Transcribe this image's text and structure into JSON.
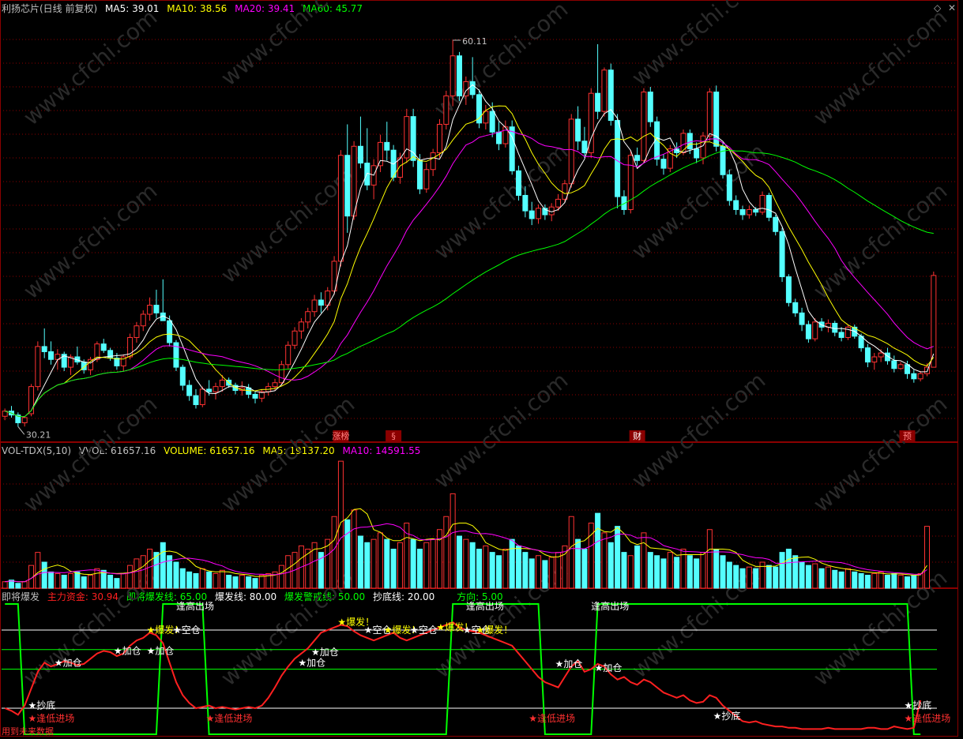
{
  "colors": {
    "bg": "#000000",
    "up": "#ff3232",
    "down": "#54ffff",
    "ma5": "#ffffff",
    "ma10": "#ffff00",
    "ma20": "#ff00ff",
    "ma60": "#00ff00",
    "grid": "#8b0000"
  },
  "main": {
    "title": "利扬芯片(日线 前复权)",
    "ma5_label": "MA5: 39.01",
    "ma10_label": "MA10: 38.56",
    "ma20_label": "MA20: 39.41",
    "ma60_label": "MA60: 45.77",
    "high_label": "60.11",
    "low_label": "30.21",
    "events": [
      "涨榜",
      "§",
      "财",
      "预"
    ]
  },
  "vol": {
    "title": "VOL-TDX(5,10)",
    "vvol_label": "VVOL: 61657.16",
    "volume_label": "VOLUME: 61657.16",
    "ma5_label": "MA5: 19137.20",
    "ma10_label": "MA10: 14591.55"
  },
  "ind": {
    "title": "即将爆发",
    "main_fund_label": "主力资金: 30.94",
    "soon_label": "即将爆发线: 65.00",
    "burst_label": "爆发线: 80.00",
    "warn_label": "爆发警戒线: 50.00",
    "bottom_label": "抄底线: 20.00",
    "dir_label": "方向: 5.00",
    "signals": {
      "chaodi": "★抄底",
      "jiacang": "★加仓",
      "baofa": "★爆发！",
      "kongcang": "★空仓",
      "dizhi": "★逢低进场",
      "top": "逢高出场"
    },
    "footer": "用到未来数据"
  },
  "chart_data": [
    {
      "type": "candlestick",
      "title": "利扬芯片(日线 前复权)",
      "ma": {
        "MA5": 39.01,
        "MA10": 38.56,
        "MA20": 39.41,
        "MA60": 45.77
      },
      "max_label": 60.11,
      "min_label": 30.21,
      "ylim": [
        29,
        62
      ],
      "ohlc": [
        [
          31.0,
          31.6,
          30.7,
          31.4
        ],
        [
          31.4,
          31.8,
          30.9,
          31.1
        ],
        [
          31.1,
          31.3,
          30.2,
          30.5
        ],
        [
          30.5,
          31.0,
          30.21,
          30.9
        ],
        [
          31.2,
          33.5,
          31.0,
          33.3
        ],
        [
          33.3,
          36.8,
          33.0,
          36.4
        ],
        [
          36.4,
          37.8,
          35.5,
          36.0
        ],
        [
          36.0,
          36.8,
          35.0,
          35.4
        ],
        [
          35.4,
          36.2,
          34.6,
          35.8
        ],
        [
          35.8,
          36.0,
          34.5,
          34.8
        ],
        [
          34.8,
          35.8,
          34.2,
          35.6
        ],
        [
          35.6,
          36.4,
          35.0,
          35.2
        ],
        [
          35.2,
          35.4,
          34.3,
          34.6
        ],
        [
          34.6,
          35.6,
          34.2,
          35.4
        ],
        [
          35.4,
          36.8,
          35.2,
          36.6
        ],
        [
          36.6,
          37.0,
          35.9,
          36.1
        ],
        [
          36.1,
          36.3,
          35.3,
          35.5
        ],
        [
          35.5,
          35.9,
          34.6,
          34.9
        ],
        [
          34.9,
          35.8,
          34.5,
          35.6
        ],
        [
          35.6,
          37.4,
          35.4,
          37.1
        ],
        [
          37.1,
          38.3,
          36.7,
          38.0
        ],
        [
          38.0,
          39.2,
          37.6,
          38.9
        ],
        [
          38.9,
          40.2,
          38.4,
          39.6
        ],
        [
          39.6,
          40.8,
          38.6,
          39.0
        ],
        [
          39.0,
          41.6,
          38.8,
          38.4
        ],
        [
          38.4,
          38.8,
          36.4,
          36.7
        ],
        [
          36.7,
          36.9,
          34.5,
          34.8
        ],
        [
          34.8,
          35.0,
          33.0,
          33.4
        ],
        [
          33.4,
          33.8,
          32.2,
          32.6
        ],
        [
          32.6,
          33.1,
          31.6,
          31.9
        ],
        [
          31.9,
          33.3,
          31.7,
          33.1
        ],
        [
          33.1,
          33.8,
          32.6,
          32.9
        ],
        [
          32.9,
          33.6,
          32.3,
          33.3
        ],
        [
          33.3,
          34.2,
          32.9,
          33.8
        ],
        [
          33.8,
          34.0,
          33.2,
          33.4
        ],
        [
          33.4,
          33.6,
          32.7,
          33.0
        ],
        [
          33.0,
          33.7,
          32.6,
          33.2
        ],
        [
          33.2,
          33.5,
          32.4,
          32.7
        ],
        [
          32.7,
          33.0,
          32.0,
          32.4
        ],
        [
          32.4,
          33.1,
          32.1,
          32.9
        ],
        [
          32.9,
          33.6,
          32.6,
          33.3
        ],
        [
          33.3,
          33.9,
          33.0,
          33.6
        ],
        [
          33.6,
          35.3,
          33.4,
          35.0
        ],
        [
          35.0,
          36.8,
          34.7,
          36.5
        ],
        [
          36.5,
          37.9,
          36.2,
          37.6
        ],
        [
          37.6,
          38.6,
          37.0,
          38.3
        ],
        [
          38.3,
          39.4,
          37.8,
          39.1
        ],
        [
          39.1,
          40.4,
          38.7,
          40.0
        ],
        [
          40.0,
          40.6,
          39.0,
          39.6
        ],
        [
          39.6,
          41.0,
          39.2,
          40.7
        ],
        [
          40.7,
          43.4,
          40.4,
          43.0
        ],
        [
          43.0,
          51.6,
          42.6,
          51.2
        ],
        [
          51.2,
          53.6,
          45.2,
          46.5
        ],
        [
          46.5,
          52.3,
          46.2,
          51.9
        ],
        [
          51.9,
          54.2,
          50.2,
          50.6
        ],
        [
          50.6,
          53.3,
          48.5,
          48.9
        ],
        [
          48.9,
          50.9,
          47.8,
          50.4
        ],
        [
          50.4,
          52.8,
          49.9,
          52.2
        ],
        [
          52.2,
          53.8,
          50.8,
          51.6
        ],
        [
          51.6,
          52.0,
          49.2,
          49.5
        ],
        [
          49.5,
          51.4,
          49.0,
          51.0
        ],
        [
          51.0,
          54.8,
          50.6,
          54.2
        ],
        [
          54.2,
          54.8,
          50.3,
          50.8
        ],
        [
          50.8,
          51.3,
          48.2,
          48.6
        ],
        [
          48.6,
          50.6,
          48.3,
          50.1
        ],
        [
          50.1,
          51.7,
          49.6,
          51.4
        ],
        [
          51.4,
          54.0,
          51.0,
          53.6
        ],
        [
          53.6,
          56.2,
          53.2,
          55.8
        ],
        [
          55.8,
          60.11,
          55.0,
          58.9
        ],
        [
          58.9,
          59.2,
          55.4,
          55.8
        ],
        [
          55.8,
          57.3,
          55.1,
          56.9
        ],
        [
          56.9,
          58.8,
          55.6,
          55.9
        ],
        [
          55.9,
          56.3,
          53.3,
          53.7
        ],
        [
          53.7,
          55.1,
          53.2,
          54.6
        ],
        [
          54.6,
          55.3,
          52.6,
          53.0
        ],
        [
          53.0,
          53.8,
          51.6,
          52.1
        ],
        [
          52.1,
          53.9,
          51.8,
          53.4
        ],
        [
          53.4,
          53.9,
          49.7,
          50.0
        ],
        [
          50.0,
          50.4,
          47.7,
          48.1
        ],
        [
          48.1,
          48.8,
          46.4,
          46.9
        ],
        [
          46.9,
          47.6,
          45.8,
          46.3
        ],
        [
          46.3,
          47.4,
          45.9,
          47.1
        ],
        [
          47.1,
          47.4,
          46.2,
          46.6
        ],
        [
          46.6,
          47.5,
          46.1,
          47.2
        ],
        [
          47.2,
          48.2,
          46.9,
          47.8
        ],
        [
          47.8,
          49.3,
          47.5,
          49.0
        ],
        [
          49.0,
          54.4,
          48.7,
          54.0
        ],
        [
          54.0,
          55.0,
          51.6,
          52.3
        ],
        [
          52.3,
          53.4,
          51.0,
          51.4
        ],
        [
          51.4,
          56.4,
          51.0,
          56.0
        ],
        [
          56.0,
          59.8,
          54.0,
          54.6
        ],
        [
          54.6,
          58.0,
          54.2,
          57.8
        ],
        [
          57.8,
          58.3,
          53.5,
          53.9
        ],
        [
          53.9,
          54.4,
          47.1,
          48.0
        ],
        [
          48.0,
          48.5,
          46.6,
          47.0
        ],
        [
          47.0,
          51.6,
          46.7,
          51.2
        ],
        [
          51.2,
          51.8,
          50.4,
          50.8
        ],
        [
          50.8,
          56.4,
          50.6,
          56.1
        ],
        [
          56.1,
          56.5,
          53.4,
          53.8
        ],
        [
          53.8,
          54.2,
          50.4,
          50.9
        ],
        [
          50.9,
          51.3,
          49.7,
          50.2
        ],
        [
          50.2,
          52.0,
          49.9,
          51.7
        ],
        [
          51.7,
          52.2,
          51.0,
          51.4
        ],
        [
          51.4,
          53.2,
          51.2,
          52.9
        ],
        [
          52.9,
          53.2,
          51.3,
          51.7
        ],
        [
          51.7,
          52.2,
          50.6,
          51.0
        ],
        [
          51.0,
          53.0,
          50.5,
          52.7
        ],
        [
          52.7,
          56.4,
          52.3,
          56.1
        ],
        [
          56.1,
          56.6,
          51.5,
          51.9
        ],
        [
          51.9,
          52.2,
          49.4,
          49.7
        ],
        [
          49.7,
          50.1,
          47.3,
          47.7
        ],
        [
          47.7,
          48.1,
          46.6,
          47.0
        ],
        [
          47.0,
          47.3,
          46.2,
          46.6
        ],
        [
          46.6,
          47.3,
          46.3,
          47.0
        ],
        [
          47.0,
          47.2,
          46.5,
          46.8
        ],
        [
          46.8,
          48.4,
          46.6,
          48.1
        ],
        [
          48.1,
          48.3,
          46.1,
          46.4
        ],
        [
          46.4,
          46.6,
          45.0,
          45.3
        ],
        [
          45.3,
          45.6,
          41.4,
          41.8
        ],
        [
          41.8,
          42.0,
          39.5,
          39.8
        ],
        [
          39.8,
          40.1,
          38.7,
          39.0
        ],
        [
          39.0,
          39.4,
          37.6,
          38.1
        ],
        [
          38.1,
          38.4,
          36.7,
          37.0
        ],
        [
          37.0,
          38.6,
          36.8,
          38.3
        ],
        [
          38.3,
          38.6,
          37.6,
          37.9
        ],
        [
          37.9,
          38.5,
          37.5,
          38.2
        ],
        [
          38.2,
          38.4,
          37.2,
          37.5
        ],
        [
          37.5,
          37.9,
          36.8,
          37.1
        ],
        [
          37.1,
          38.1,
          36.9,
          37.9
        ],
        [
          37.9,
          38.1,
          37.0,
          37.2
        ],
        [
          37.2,
          37.4,
          36.0,
          36.3
        ],
        [
          36.3,
          36.6,
          34.8,
          35.2
        ],
        [
          35.2,
          35.9,
          34.6,
          35.6
        ],
        [
          35.6,
          36.2,
          35.2,
          35.9
        ],
        [
          35.9,
          36.3,
          35.0,
          35.3
        ],
        [
          35.3,
          35.7,
          34.4,
          34.7
        ],
        [
          34.7,
          35.2,
          34.6,
          35.0
        ],
        [
          35.0,
          35.3,
          33.9,
          34.3
        ],
        [
          34.3,
          34.6,
          33.6,
          33.9
        ],
        [
          33.9,
          34.5,
          33.7,
          34.3
        ],
        [
          34.3,
          35.1,
          34.1,
          34.8
        ],
        [
          34.8,
          42.2,
          36.8,
          41.9
        ]
      ],
      "volume": [
        4,
        5,
        3,
        4,
        14,
        22,
        16,
        10,
        9,
        8,
        9,
        10,
        7,
        8,
        12,
        11,
        8,
        6,
        9,
        14,
        18,
        20,
        24,
        22,
        28,
        20,
        16,
        12,
        10,
        9,
        12,
        10,
        9,
        11,
        8,
        7,
        8,
        7,
        6,
        8,
        9,
        10,
        14,
        20,
        22,
        26,
        24,
        28,
        22,
        30,
        44,
        78,
        42,
        48,
        32,
        28,
        30,
        34,
        30,
        24,
        28,
        40,
        30,
        24,
        28,
        30,
        36,
        44,
        58,
        32,
        30,
        28,
        24,
        26,
        22,
        20,
        24,
        30,
        26,
        22,
        18,
        20,
        17,
        19,
        22,
        26,
        44,
        30,
        24,
        40,
        46,
        34,
        28,
        38,
        22,
        20,
        26,
        34,
        22,
        20,
        18,
        22,
        19,
        24,
        20,
        18,
        22,
        36,
        24,
        20,
        16,
        14,
        12,
        13,
        12,
        16,
        14,
        13,
        22,
        24,
        20,
        16,
        14,
        15,
        12,
        13,
        11,
        10,
        12,
        10,
        9,
        8,
        9,
        10,
        8,
        9,
        8,
        7,
        8,
        9,
        38
      ],
      "ylim_volume": [
        0,
        80
      ]
    },
    {
      "type": "line",
      "title": "即将爆发",
      "levels": {
        "即将爆发线": 65,
        "爆发线": 80,
        "爆发警戒线": 50,
        "抄底线": 20
      },
      "last": {
        "主力资金": 30.94,
        "方向": 5.0
      },
      "ylim": [
        0,
        100
      ],
      "fund": [
        20,
        18,
        15,
        22,
        35,
        48,
        55,
        52,
        54,
        56,
        55,
        53,
        54,
        58,
        62,
        64,
        63,
        60,
        62,
        68,
        72,
        74,
        78,
        76,
        70,
        55,
        40,
        30,
        24,
        20,
        21,
        22,
        20,
        21,
        20,
        19,
        20,
        21,
        20,
        22,
        28,
        36,
        45,
        52,
        58,
        62,
        66,
        72,
        78,
        80,
        82,
        84,
        83,
        79,
        76,
        74,
        72,
        74,
        76,
        78,
        74,
        72,
        74,
        76,
        78,
        80,
        82,
        84,
        86,
        82,
        80,
        79,
        78,
        76,
        74,
        72,
        70,
        68,
        62,
        56,
        50,
        44,
        40,
        38,
        36,
        44,
        52,
        56,
        48,
        50,
        54,
        52,
        46,
        42,
        44,
        40,
        38,
        42,
        40,
        36,
        32,
        30,
        28,
        30,
        26,
        24,
        25,
        30,
        28,
        22,
        18,
        14,
        10,
        9,
        10,
        8,
        7,
        6,
        6,
        5,
        5,
        4,
        4,
        4,
        4,
        5,
        4,
        4,
        4,
        4,
        4,
        5,
        5,
        4,
        4,
        6,
        5,
        4,
        5,
        26
      ],
      "direction": [
        100,
        100,
        100,
        0,
        0,
        0,
        0,
        0,
        0,
        0,
        0,
        0,
        0,
        0,
        0,
        0,
        0,
        0,
        0,
        0,
        0,
        0,
        0,
        0,
        100,
        100,
        100,
        100,
        100,
        100,
        100,
        0,
        0,
        0,
        0,
        0,
        0,
        0,
        0,
        0,
        0,
        0,
        0,
        0,
        0,
        0,
        0,
        0,
        0,
        0,
        0,
        0,
        0,
        0,
        0,
        0,
        0,
        0,
        0,
        0,
        0,
        0,
        0,
        0,
        0,
        0,
        0,
        0,
        100,
        100,
        100,
        100,
        100,
        100,
        100,
        100,
        100,
        100,
        100,
        100,
        100,
        100,
        0,
        0,
        0,
        0,
        0,
        0,
        0,
        0,
        100,
        100,
        100,
        100,
        100,
        100,
        100,
        100,
        100,
        100,
        100,
        100,
        100,
        100,
        100,
        100,
        100,
        100,
        100,
        100,
        100,
        100,
        100,
        100,
        100,
        100,
        100,
        100,
        100,
        100,
        100,
        100,
        100,
        100,
        100,
        100,
        100,
        100,
        100,
        100,
        100,
        100,
        100,
        100,
        100,
        100,
        100,
        100,
        0,
        0
      ]
    }
  ]
}
